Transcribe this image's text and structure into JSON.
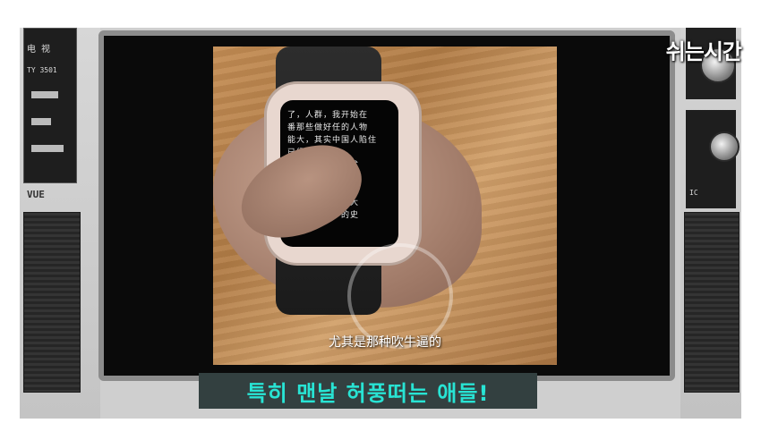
{
  "channel_logo": "쉬는시간",
  "video": {
    "subtitle_cn": "尤其是那种吹牛逼的",
    "watch_text": "了，人群，我开始在\n番那些做好任的人物\n能大，其实中国人陷住\n已经人的面孔\n都已经快死了，尤\n其是那种吹牛，多\n都是代而现在我们\n什么工具什么四大\n吧都变了吗？的史"
  },
  "caption_kr": "특히 맨날 허풍떠는 애들!",
  "tv_brand": {
    "left_top": "电 视",
    "left_model": "TY 3501",
    "left_mark": "VUE",
    "right_label": "IC"
  }
}
